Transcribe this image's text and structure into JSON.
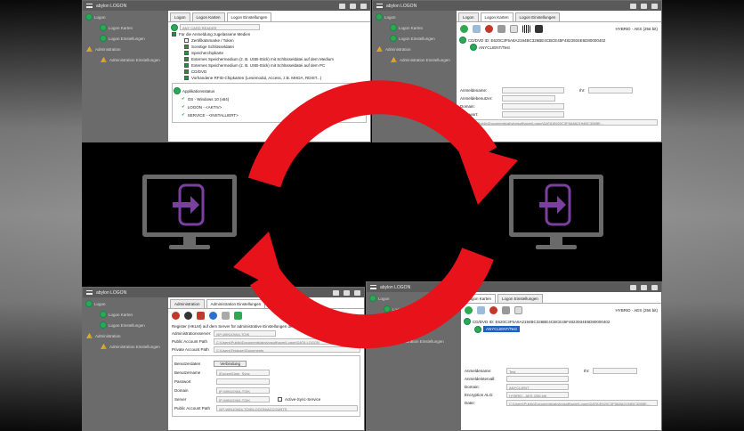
{
  "app": {
    "title": "abylon LOGON",
    "title_br": "abylon LOGON"
  },
  "nav": {
    "items": [
      {
        "label": "Logon"
      },
      {
        "label": "Logon Karten"
      },
      {
        "label": "Logon Einstellungen"
      },
      {
        "label": "Administration"
      },
      {
        "label": "Administration Einstellungen"
      }
    ]
  },
  "tl": {
    "tabs": [
      "Logon",
      "Logon Karten",
      "Logon Einstellungen"
    ],
    "reader": "ANY CARD READER",
    "section": "Für die Anmeldung zugelassene Medien",
    "media": [
      {
        "label": "Zertifikatsmarke / Token",
        "on": false
      },
      {
        "label": "Sonstige Schlüsseldatei",
        "on": true
      },
      {
        "label": "Speicherchipkarte",
        "on": true
      },
      {
        "label": "Externes Speichermedium (z. B. USB-Stick) mit Schlüsseldatei auf dem Medium",
        "on": true
      },
      {
        "label": "Externes Speichermedium (z. B. USB-Stick) mit Schlüsseldatei auf dem PC",
        "on": true
      },
      {
        "label": "CD/DVD",
        "on": true
      },
      {
        "label": "Vorhandene RFID-Chipkarten (Lesemodul, Access, z.B. MHDA, RDIST...)",
        "on": true
      }
    ],
    "apps_header": "Applikationsstatus",
    "apps": [
      "OS - Windows 10 (x64)",
      "LOGON - <AKTIV>",
      "SERVICE - <INSTALLIERT>"
    ]
  },
  "tr": {
    "tabs": [
      "Logon",
      "Logon Karten",
      "Logon Einstellungen"
    ],
    "hybrid": "HYBRID - AES (256 bit)",
    "cd_id": "CD/DVD ID: E620C3F5A8A2194BC326BE4CBCE45F4823934E6D80000402",
    "client": "ANYCLIENT/Test",
    "f_user": "Anmeldename:",
    "f_domain_lbl": "Anmeldebenutzer:",
    "f_dom": "Domain:",
    "f_key": "Kennwort:",
    "f_over": "Ihr:",
    "path": "C:\\Users\\Public\\Documents\\abylonsoft\\apm\\Logon\\DATA\\E620C3F5A8A2194BC326BE..."
  },
  "bl": {
    "tabs": [
      "Administration",
      "Administration Einstellungen"
    ],
    "info": "Register (HKLM) auf dem Server für administrative Einstellungen der Anwender Hinweis",
    "server_lbl": "Administrationsserver:",
    "server": "\\\\IP-WIN10X64-TOIK",
    "pub_lbl": "Public Account Path",
    "pub": "C:\\Users\\Public\\Documents\\abylonsoft\\apm\\Logon\\DATA LOGON",
    "priv_lbl": "Private Account Path",
    "priv": "C:\\Users\\Testuser\\Documents",
    "group_title": "Benutzerdaten",
    "group_btn": "Verbindung",
    "user_lbl": "Benutzername",
    "user": "\\Europe\\User_Sync",
    "pw_lbl": "Passwort",
    "domain_lbl": "Domain",
    "domain": "IP-WIN10X64-TOIK",
    "srv_lbl": "Server",
    "srv": "IP-WIN10X64-TOIK",
    "sync": "Active-Sync-Service",
    "pub2_lbl": "Public Account Path",
    "pub2": "\\\\IP-WIN10X64-TOIK\\LOGON\\ACCOUNTS"
  },
  "br": {
    "tabs": [
      "Logon Karten",
      "Logon Einstellungen"
    ],
    "hybrid": "HYBRID - AES (256 bit)",
    "cd_id": "CD/DVD ID: E620C3F5A8A2194BC326BE4CBCE45F4823934E6D80000402",
    "client": "ANYCLIENT/Test",
    "f_user_lbl": "Anmeldename:",
    "f_user": "Test",
    "f_dom_lbl": "Anmeldeintervall:",
    "f_domain_lbl": "Domain:",
    "f_domain": "ANYCLIENT",
    "f_enc_lbl": "Encryption ALG:",
    "f_enc": "HYBRID - AES (256 bit)",
    "f_data_lbl": "Datei:",
    "f_data": "C:\\Users\\Public\\Documents\\abylonsoft\\apm\\Logon\\DATA\\E620C3F5A8A2194BC326BE...",
    "f_ihr": "Ihr:"
  },
  "colors": {
    "arrow": "#e8121a",
    "nav": "#6b6b6b",
    "logon_icon": "#7b3fa0"
  },
  "icons": [
    "hamburger-icon",
    "cart-icon",
    "help-icon",
    "refresh-icon",
    "logon-icon",
    "card-reader-icon"
  ]
}
